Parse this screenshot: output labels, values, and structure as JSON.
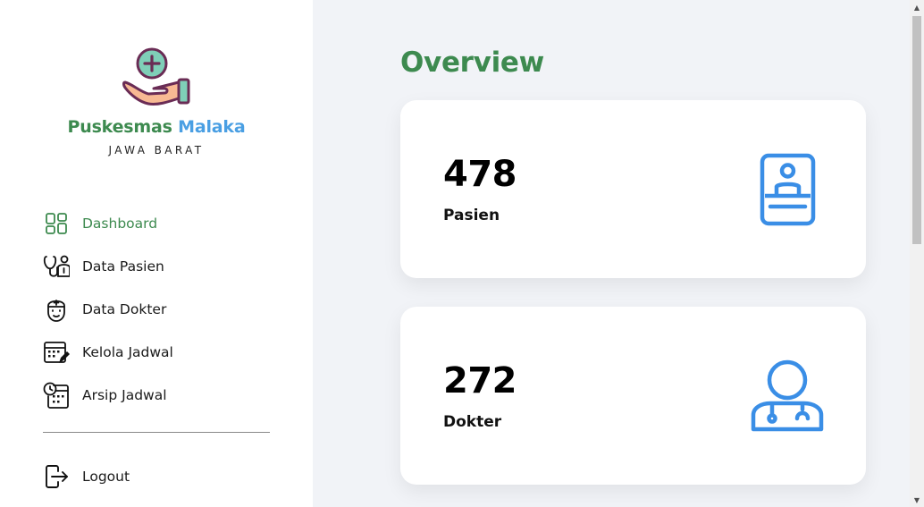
{
  "sidebar": {
    "brand_name_part1": "Puskesmas",
    "brand_name_part2": "Malaka",
    "region": "JAWA BARAT",
    "items": [
      {
        "label": "Dashboard",
        "icon": "dashboard-grid-icon",
        "active": true
      },
      {
        "label": "Data Pasien",
        "icon": "stethoscope-icon",
        "active": false
      },
      {
        "label": "Data Dokter",
        "icon": "doctor-head-icon",
        "active": false
      },
      {
        "label": "Kelola Jadwal",
        "icon": "calendar-edit-icon",
        "active": false
      },
      {
        "label": "Arsip Jadwal",
        "icon": "calendar-clock-icon",
        "active": false
      }
    ],
    "logout_label": "Logout"
  },
  "main": {
    "title": "Overview",
    "cards": [
      {
        "value": "478",
        "label": "Pasien",
        "icon": "patient-id-card-icon"
      },
      {
        "value": "272",
        "label": "Dokter",
        "icon": "doctor-person-icon"
      }
    ]
  },
  "colors": {
    "brand_green": "#3d8a4f",
    "brand_blue": "#4a9fe3",
    "icon_blue": "#3a8ee6",
    "background": "#f1f3f7"
  }
}
